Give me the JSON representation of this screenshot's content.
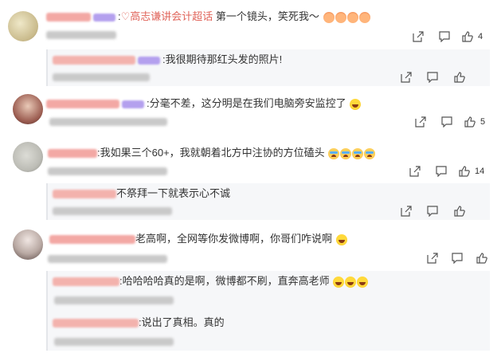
{
  "colors": {
    "link": "#e0645a",
    "panel": "#f6f7f9",
    "icon": "#555555"
  },
  "comments": [
    {
      "avatar_color": "#d6cca6",
      "text_prefix": ":",
      "topic": "高志谦讲会计超话",
      "text": " 第一个镜头，笑死我～",
      "emojis": [
        "fire-icon",
        "fire-icon",
        "fire-icon",
        "fire-icon"
      ],
      "like_count": "4",
      "replies": [
        {
          "text": ":我很期待那红头发的照片!",
          "emojis": []
        }
      ]
    },
    {
      "avatar_color": "#a26a5c",
      "text": ":分毫不差，这分明是在我们电脑旁安监控了",
      "emojis": [
        "laugh-icon"
      ],
      "like_count": "5",
      "replies": []
    },
    {
      "avatar_color": "#c8c8c0",
      "text": ":我如果三个60+，我就朝着北方中注协的方位磕头",
      "emojis": [
        "cry-icon",
        "cry-icon",
        "cry-icon",
        "cry-icon"
      ],
      "like_count": "14",
      "replies": [
        {
          "text": "不祭拜一下就表示心不诚",
          "emojis": []
        }
      ]
    },
    {
      "avatar_color": "#9a8f8a",
      "text": "老高啊，全网等你发微博啊，你哥们咋说啊",
      "emojis": [
        "laugh-icon"
      ],
      "like_count": "",
      "replies": [
        {
          "text": ":哈哈哈哈真的是啊，微博都不刷，直奔高老师",
          "emojis": [
            "laugh-icon",
            "laugh-icon",
            "laugh-icon"
          ]
        },
        {
          "text": ":说出了真相。真的",
          "emojis": []
        }
      ]
    }
  ]
}
